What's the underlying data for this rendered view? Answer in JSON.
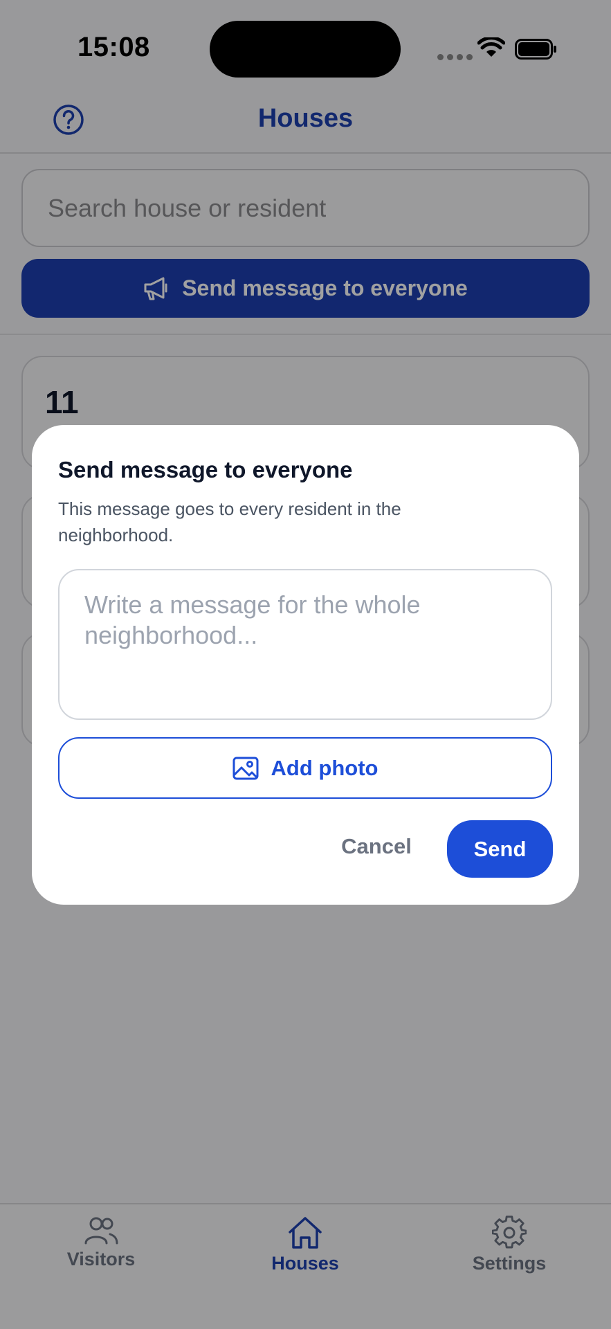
{
  "status_bar": {
    "time": "15:08"
  },
  "header": {
    "title": "Houses",
    "help_icon": "question-circle-icon"
  },
  "search": {
    "placeholder": "Search house or resident",
    "value": ""
  },
  "broadcast_button": {
    "label": "Send message to everyone",
    "icon": "megaphone-icon"
  },
  "houses": [
    {
      "number": "11"
    },
    {
      "number": ""
    },
    {
      "number": ""
    }
  ],
  "modal": {
    "title": "Send message to everyone",
    "description": "This message goes to every resident in the neighborhood.",
    "message_placeholder": "Write a message for the whole neighborhood...",
    "add_photo_label": "Add photo",
    "add_photo_icon": "image-icon",
    "cancel_label": "Cancel",
    "send_label": "Send"
  },
  "tabs": [
    {
      "label": "Visitors",
      "icon": "users-icon",
      "active": false
    },
    {
      "label": "Houses",
      "icon": "home-icon",
      "active": true
    },
    {
      "label": "Settings",
      "icon": "gear-icon",
      "active": false
    }
  ],
  "colors": {
    "primary": "#1d4ed8",
    "header_accent": "#1e40af",
    "overlay": "rgba(0,0,0,0.37)"
  }
}
